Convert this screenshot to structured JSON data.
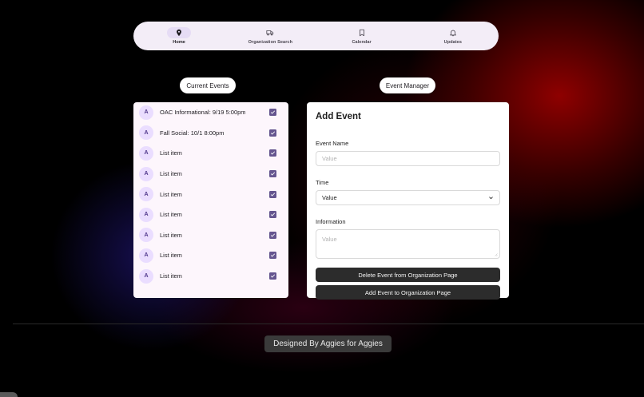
{
  "nav": {
    "items": [
      {
        "label": "Home",
        "icon": "location-pin-icon",
        "active": true
      },
      {
        "label": "Organization Search",
        "icon": "truck-icon",
        "active": false
      },
      {
        "label": "Calendar",
        "icon": "bookmark-icon",
        "active": false
      },
      {
        "label": "Updates",
        "icon": "bell-icon",
        "active": false
      }
    ]
  },
  "chips": {
    "current_events": "Current Events",
    "event_manager": "Event Manager"
  },
  "events": {
    "avatar_letter": "A",
    "items": [
      {
        "label": "OAC Informational: 9/19 5:00pm",
        "checked": true
      },
      {
        "label": "Fall Social: 10/1 8:00pm",
        "checked": true
      },
      {
        "label": "List item",
        "checked": true
      },
      {
        "label": "List item",
        "checked": true
      },
      {
        "label": "List item",
        "checked": true
      },
      {
        "label": "List item",
        "checked": true
      },
      {
        "label": "List item",
        "checked": true
      },
      {
        "label": "List item",
        "checked": true
      },
      {
        "label": "List item",
        "checked": true
      }
    ]
  },
  "form": {
    "title": "Add Event",
    "event_name_label": "Event Name",
    "event_name_placeholder": "Value",
    "time_label": "Time",
    "time_value": "Value",
    "information_label": "Information",
    "information_placeholder": "Value",
    "delete_button": "Delete Event from Organization Page",
    "add_button": "Add Event to Organization Page"
  },
  "footer": {
    "text": "Designed By Aggies for Aggies"
  },
  "colors": {
    "accent": "#65558f",
    "avatar_bg": "#eaddff",
    "button_bg": "#2c2c2c"
  }
}
